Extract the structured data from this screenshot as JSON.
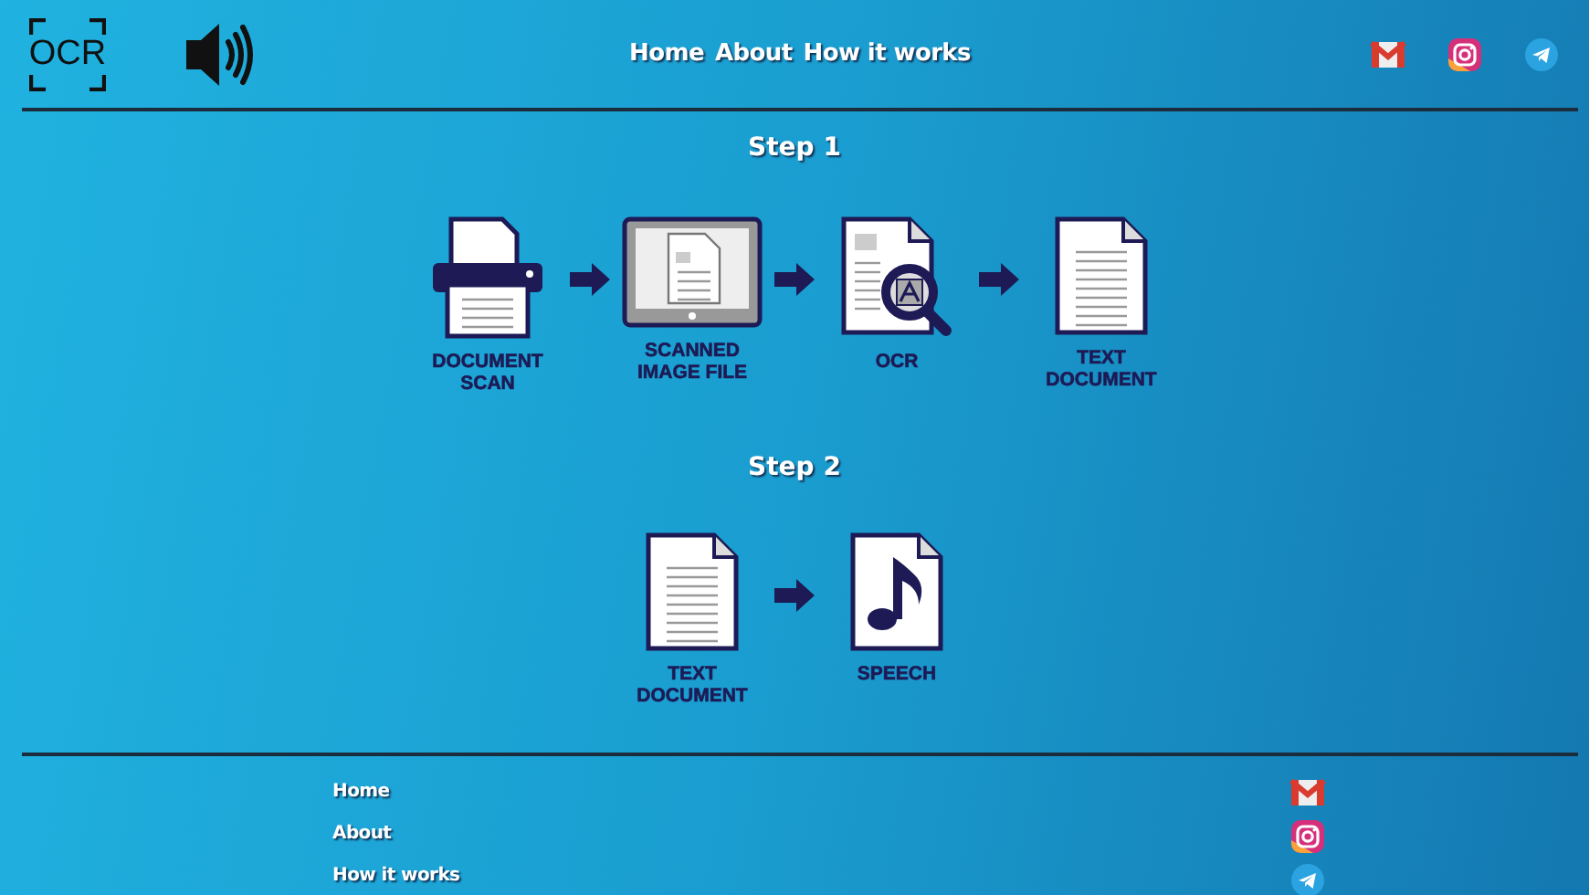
{
  "logo": {
    "text": "OCR"
  },
  "nav": [
    {
      "label": "Home"
    },
    {
      "label": "About"
    },
    {
      "label": "How it works"
    }
  ],
  "social": [
    {
      "kind": "mail"
    },
    {
      "kind": "instagram"
    },
    {
      "kind": "telegram"
    }
  ],
  "steps": [
    {
      "title": "Step 1",
      "stages": [
        {
          "kind": "scanner",
          "label": "DOCUMENT\nSCAN"
        },
        {
          "kind": "scanned-image",
          "label": "SCANNED\nIMAGE FILE"
        },
        {
          "kind": "ocr",
          "label": "OCR"
        },
        {
          "kind": "text-document",
          "label": "TEXT\nDOCUMENT"
        }
      ]
    },
    {
      "title": "Step 2",
      "stages": [
        {
          "kind": "text-document",
          "label": "TEXT\nDOCUMENT"
        },
        {
          "kind": "speech",
          "label": "SPEECH"
        }
      ]
    }
  ],
  "footer": {
    "links": [
      {
        "label": "Home"
      },
      {
        "label": "About"
      },
      {
        "label": "How it works"
      }
    ],
    "social": [
      {
        "kind": "mail"
      },
      {
        "kind": "instagram"
      },
      {
        "kind": "telegram"
      }
    ]
  }
}
